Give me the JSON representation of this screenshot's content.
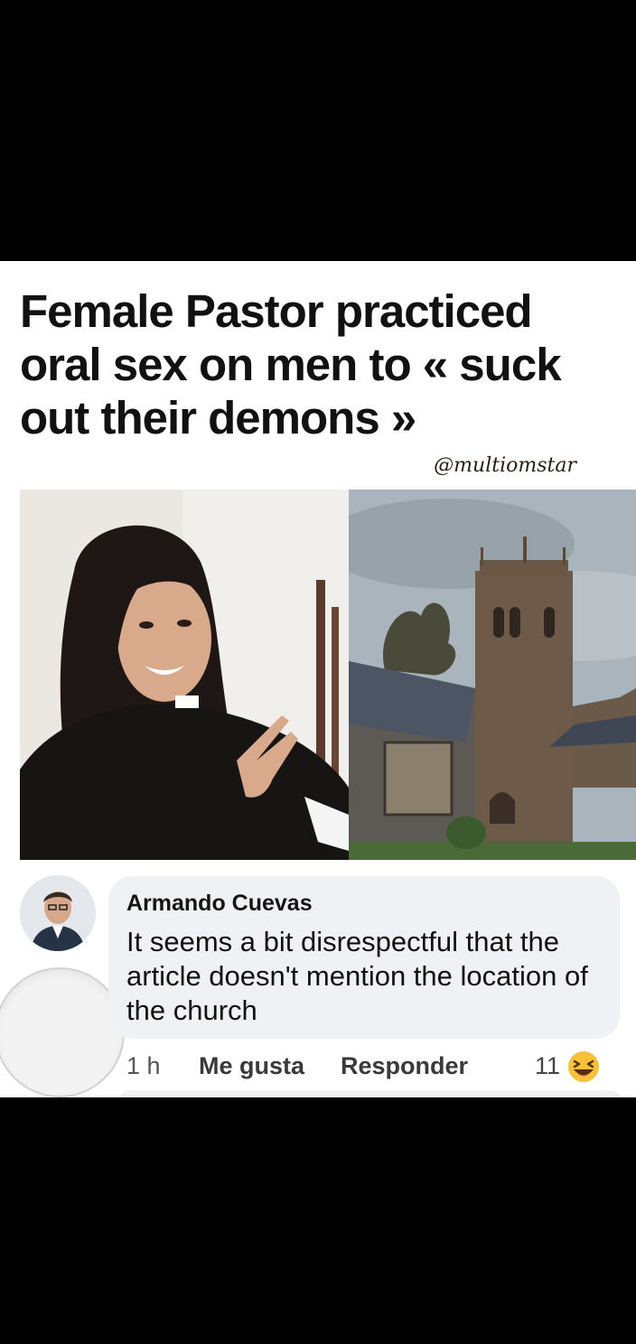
{
  "post": {
    "headline": "Female Pastor practiced oral sex on men to « suck out their demons »",
    "watermark": "@multiomstar"
  },
  "images": {
    "left": "woman-pastor-photo",
    "right": "stone-church-photo"
  },
  "comment": {
    "author": "Armando Cuevas",
    "text": "It seems a bit disrespectful that the article doesn't mention the location of the church",
    "time": "1 h",
    "like_label": "Me gusta",
    "reply_label": "Responder",
    "reaction_count": "11",
    "reaction_icon": "laughing-emoji-icon"
  },
  "colors": {
    "background": "#000000",
    "panel": "#ffffff",
    "bubble": "#eff1f4",
    "reaction": "#f7c23a"
  }
}
